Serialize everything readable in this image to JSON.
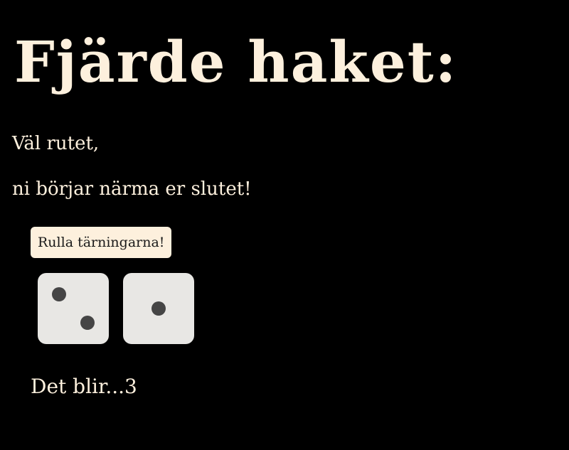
{
  "page": {
    "title": "Fjärde haket:",
    "intro_line_1": "Väl rutet,",
    "intro_line_2": "ni börjar närma er slutet!"
  },
  "controls": {
    "roll_button_label": "Rulla tärningarna!"
  },
  "dice": {
    "values": [
      2,
      1
    ]
  },
  "result": {
    "text": "Det blir...3"
  },
  "colors": {
    "background": "#000000",
    "text": "#fdf0dd",
    "button_bg": "#fdf0dd",
    "die_face": "#e8e7e4",
    "pip": "#454545"
  }
}
